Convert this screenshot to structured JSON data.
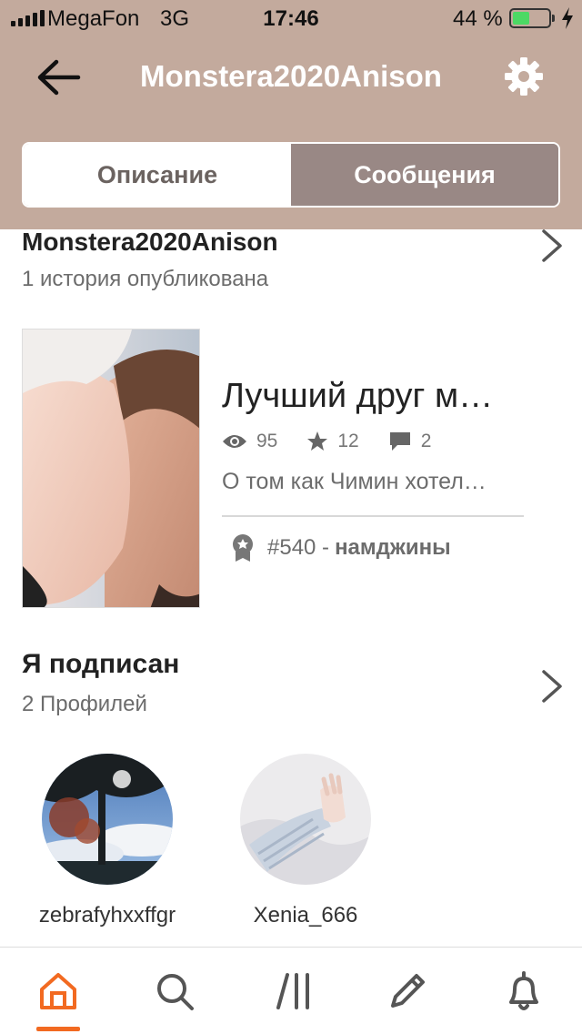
{
  "status_bar": {
    "carrier": "MegaFon",
    "network": "3G",
    "time": "17:46",
    "battery": "44 %"
  },
  "header": {
    "title": "Monstera2020Anison",
    "back_icon": "arrow-left-icon",
    "settings_icon": "gear-icon"
  },
  "tabs": {
    "description": "Описание",
    "messages": "Сообщения",
    "selected": "Сообщения"
  },
  "profile": {
    "name": "Monstera2020Anison",
    "stories_count": "1 история опубликована"
  },
  "story": {
    "title": "Лучший друг м…",
    "views": "95",
    "votes": "12",
    "comments": "2",
    "description": "О том как Чимин хотел…",
    "rank": "#540 -",
    "rank_tag": "намджины"
  },
  "following": {
    "title": "Я подписан",
    "count": "2 Профилей",
    "users": [
      {
        "name": "zebrafyhxxffgr"
      },
      {
        "name": "Xenia_666"
      }
    ]
  },
  "tabbar": {
    "items": [
      "home-icon",
      "search-icon",
      "library-icon",
      "pencil-icon",
      "bell-icon"
    ],
    "active": "home-icon",
    "active_color": "#f26a21"
  },
  "colors": {
    "header_bg": "#c3aa9d",
    "tab_selected_bg": "#998885"
  }
}
